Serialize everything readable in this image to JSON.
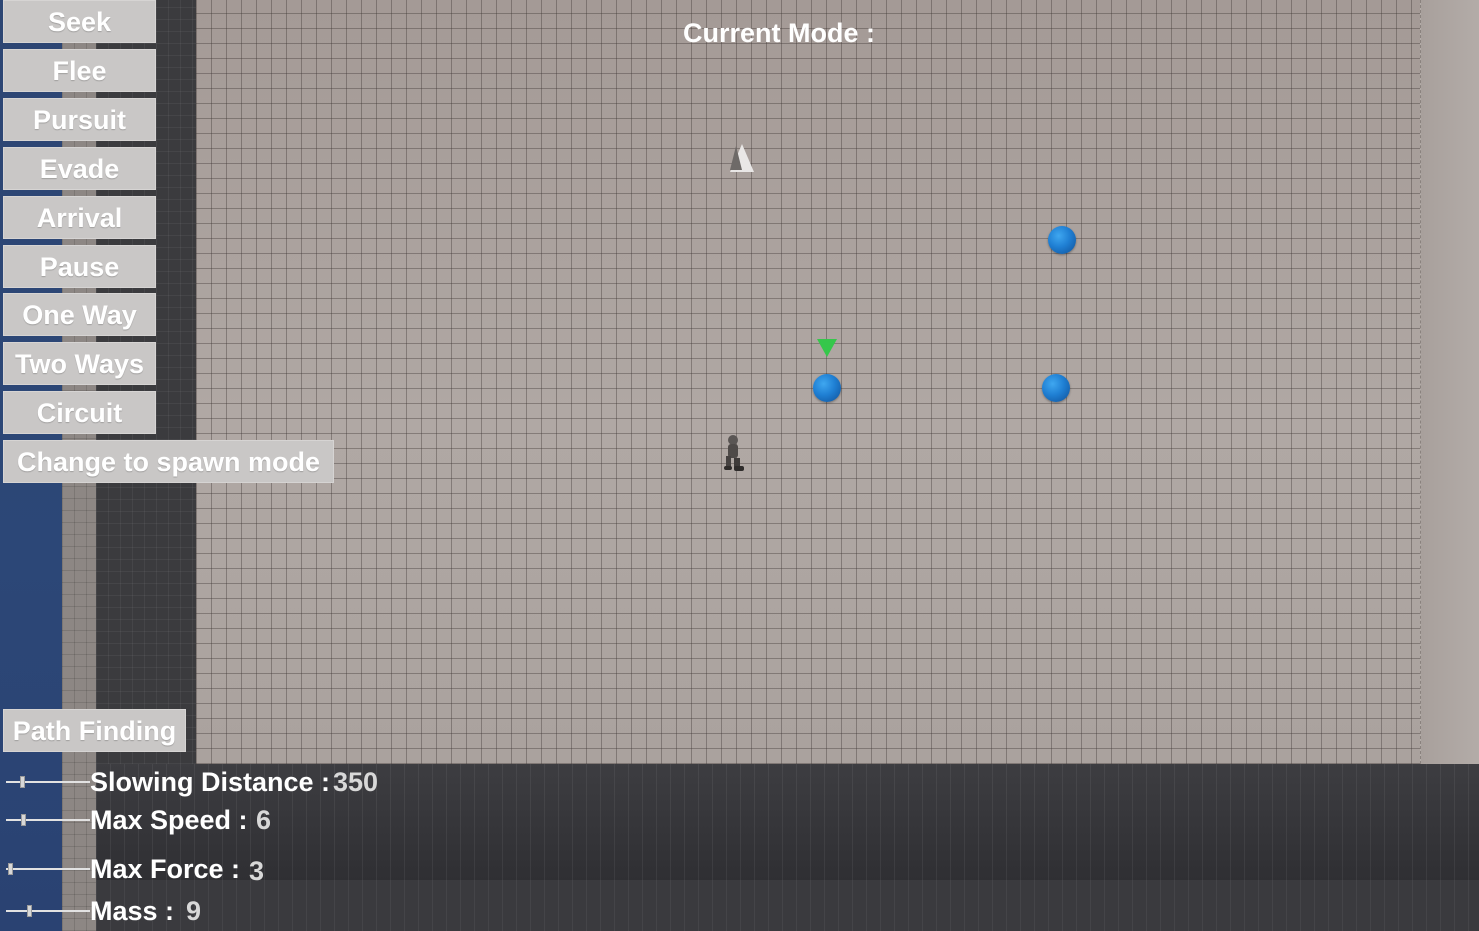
{
  "mode": {
    "label": "Current Mode :",
    "value": ""
  },
  "buttons": [
    {
      "label": "Seek"
    },
    {
      "label": "Flee"
    },
    {
      "label": "Pursuit"
    },
    {
      "label": "Evade"
    },
    {
      "label": "Arrival"
    },
    {
      "label": "Pause"
    },
    {
      "label": "One Way"
    },
    {
      "label": "Two Ways"
    },
    {
      "label": "Circuit"
    }
  ],
  "spawn_button": {
    "label": "Change to spawn mode"
  },
  "path_finding_button": {
    "label": "Path Finding"
  },
  "sliders": [
    {
      "label": "Slowing Distance :",
      "value": "350",
      "fraction": 0.18
    },
    {
      "label": "Max Speed :",
      "value": "6",
      "fraction": 0.19
    },
    {
      "label": "Max Force :",
      "value": "3",
      "fraction": 0.02
    },
    {
      "label": "Mass :",
      "value": "9",
      "fraction": 0.26
    }
  ],
  "colors": {
    "button_bg": "#c9c7c6",
    "text": "#ffffff",
    "orb_blue": "#1f7fd3",
    "arrow_green": "#35c74b"
  }
}
